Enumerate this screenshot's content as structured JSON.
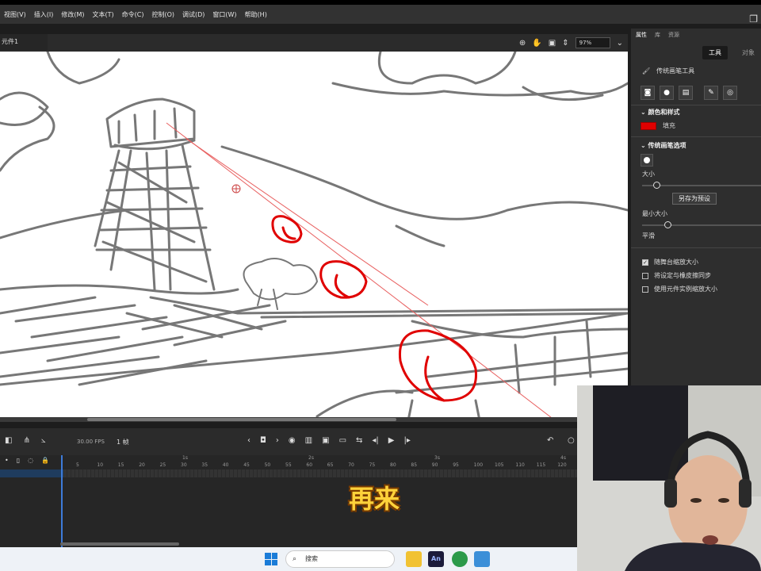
{
  "menu": [
    "视图(V)",
    "插入(I)",
    "修改(M)",
    "文本(T)",
    "命令(C)",
    "控制(O)",
    "调试(D)",
    "窗口(W)",
    "帮助(H)"
  ],
  "doc_tab": "元件1",
  "zoom": "97%",
  "panel": {
    "tabs": [
      "属性",
      "库",
      "资源"
    ],
    "tool_tabs": [
      "工具",
      "对象"
    ],
    "tool_name": "传统画笔工具",
    "color_section": "颜色和样式",
    "fill_label": "填充",
    "fill_color": "#e00000",
    "brush_section": "传统画笔选项",
    "size_label": "大小",
    "save_preset": "另存为预设",
    "min_size_label": "最小大小",
    "smooth_label": "平滑",
    "options": [
      {
        "label": "随舞台缩放大小",
        "checked": true
      },
      {
        "label": "将设定与橡皮擦同步",
        "checked": false
      },
      {
        "label": "使用元件实例缩放大小",
        "checked": false
      }
    ]
  },
  "timeline": {
    "fps": "30.00",
    "fps_unit": "FPS",
    "current_frame": "1",
    "frame_unit": "帧",
    "ruler": [
      "5",
      "10",
      "15",
      "20",
      "25",
      "30",
      "35",
      "40",
      "45",
      "50",
      "55",
      "60",
      "65",
      "70",
      "75",
      "80",
      "85",
      "90",
      "95",
      "100",
      "105",
      "110",
      "115",
      "120"
    ],
    "seconds": [
      "1s",
      "2s",
      "3s",
      "4s"
    ]
  },
  "subtitle": "再来",
  "taskbar": {
    "search_placeholder": "搜索",
    "an_label": "An"
  }
}
